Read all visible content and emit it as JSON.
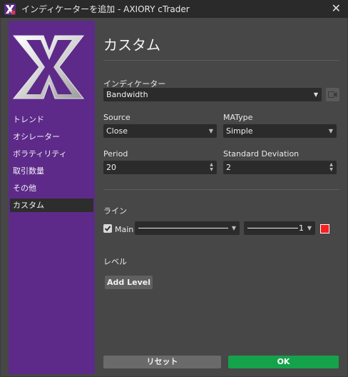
{
  "window": {
    "title": "インディケーターを追加 - AXIORY cTrader",
    "close_glyph": "✕"
  },
  "colors": {
    "sidebar": "#5d2a8a",
    "ok_button": "#14a24a",
    "line_color_swatch": "#ff1d1d"
  },
  "sidebar": {
    "logo_icon": "ctrader-x-logo",
    "items": [
      {
        "label": "トレンド"
      },
      {
        "label": "オシレーター"
      },
      {
        "label": "ボラティリティ"
      },
      {
        "label": "取引数量"
      },
      {
        "label": "その他"
      },
      {
        "label": "カスタム",
        "selected": true
      }
    ]
  },
  "main": {
    "title": "カスタム",
    "indicator": {
      "label": "インディケーター",
      "value": "Bandwidth"
    },
    "source": {
      "label": "Source",
      "value": "Close"
    },
    "matype": {
      "label": "MAType",
      "value": "Simple"
    },
    "period": {
      "label": "Period",
      "value": "20"
    },
    "stddev": {
      "label": "Standard Deviation",
      "value": "2"
    },
    "lines": {
      "label": "ライン",
      "main_checked": true,
      "main_label": "Main",
      "width_value": "1"
    },
    "levels": {
      "label": "レベル",
      "add_button": "Add Level"
    }
  },
  "footer": {
    "reset": "リセット",
    "ok": "OK"
  }
}
